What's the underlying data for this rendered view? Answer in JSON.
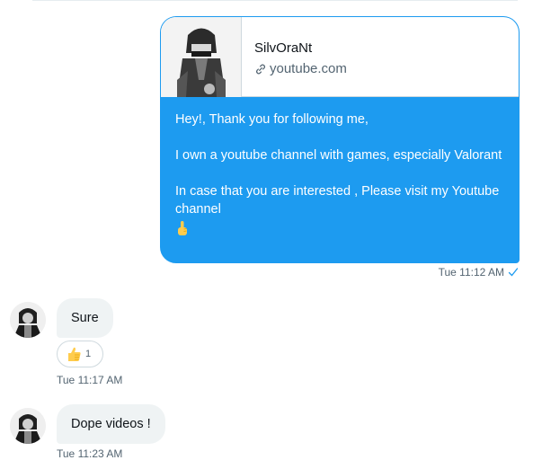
{
  "conversation": {
    "outgoing": {
      "link_preview": {
        "site_name": "SilvOraNt",
        "domain": "youtube.com"
      },
      "lines": [
        "Hey!, Thank you for following me,",
        "I own a youtube channel with games,  especially Valorant",
        "In case that you are interested , Please visit  my Youtube channel"
      ],
      "emoji": "point-up-icon",
      "timestamp": "Tue 11:12 AM",
      "status_icon": "check-icon"
    },
    "incoming": [
      {
        "text": "Sure",
        "reaction": {
          "emoji": "thumbs-up-icon",
          "count": "1"
        },
        "timestamp": "Tue 11:17 AM"
      },
      {
        "text": "Dope videos !",
        "timestamp": "Tue 11:23 AM"
      }
    ]
  },
  "colors": {
    "accent": "#1d9bf0",
    "incoming_bubble": "#eff3f4",
    "meta_text": "#536471"
  }
}
